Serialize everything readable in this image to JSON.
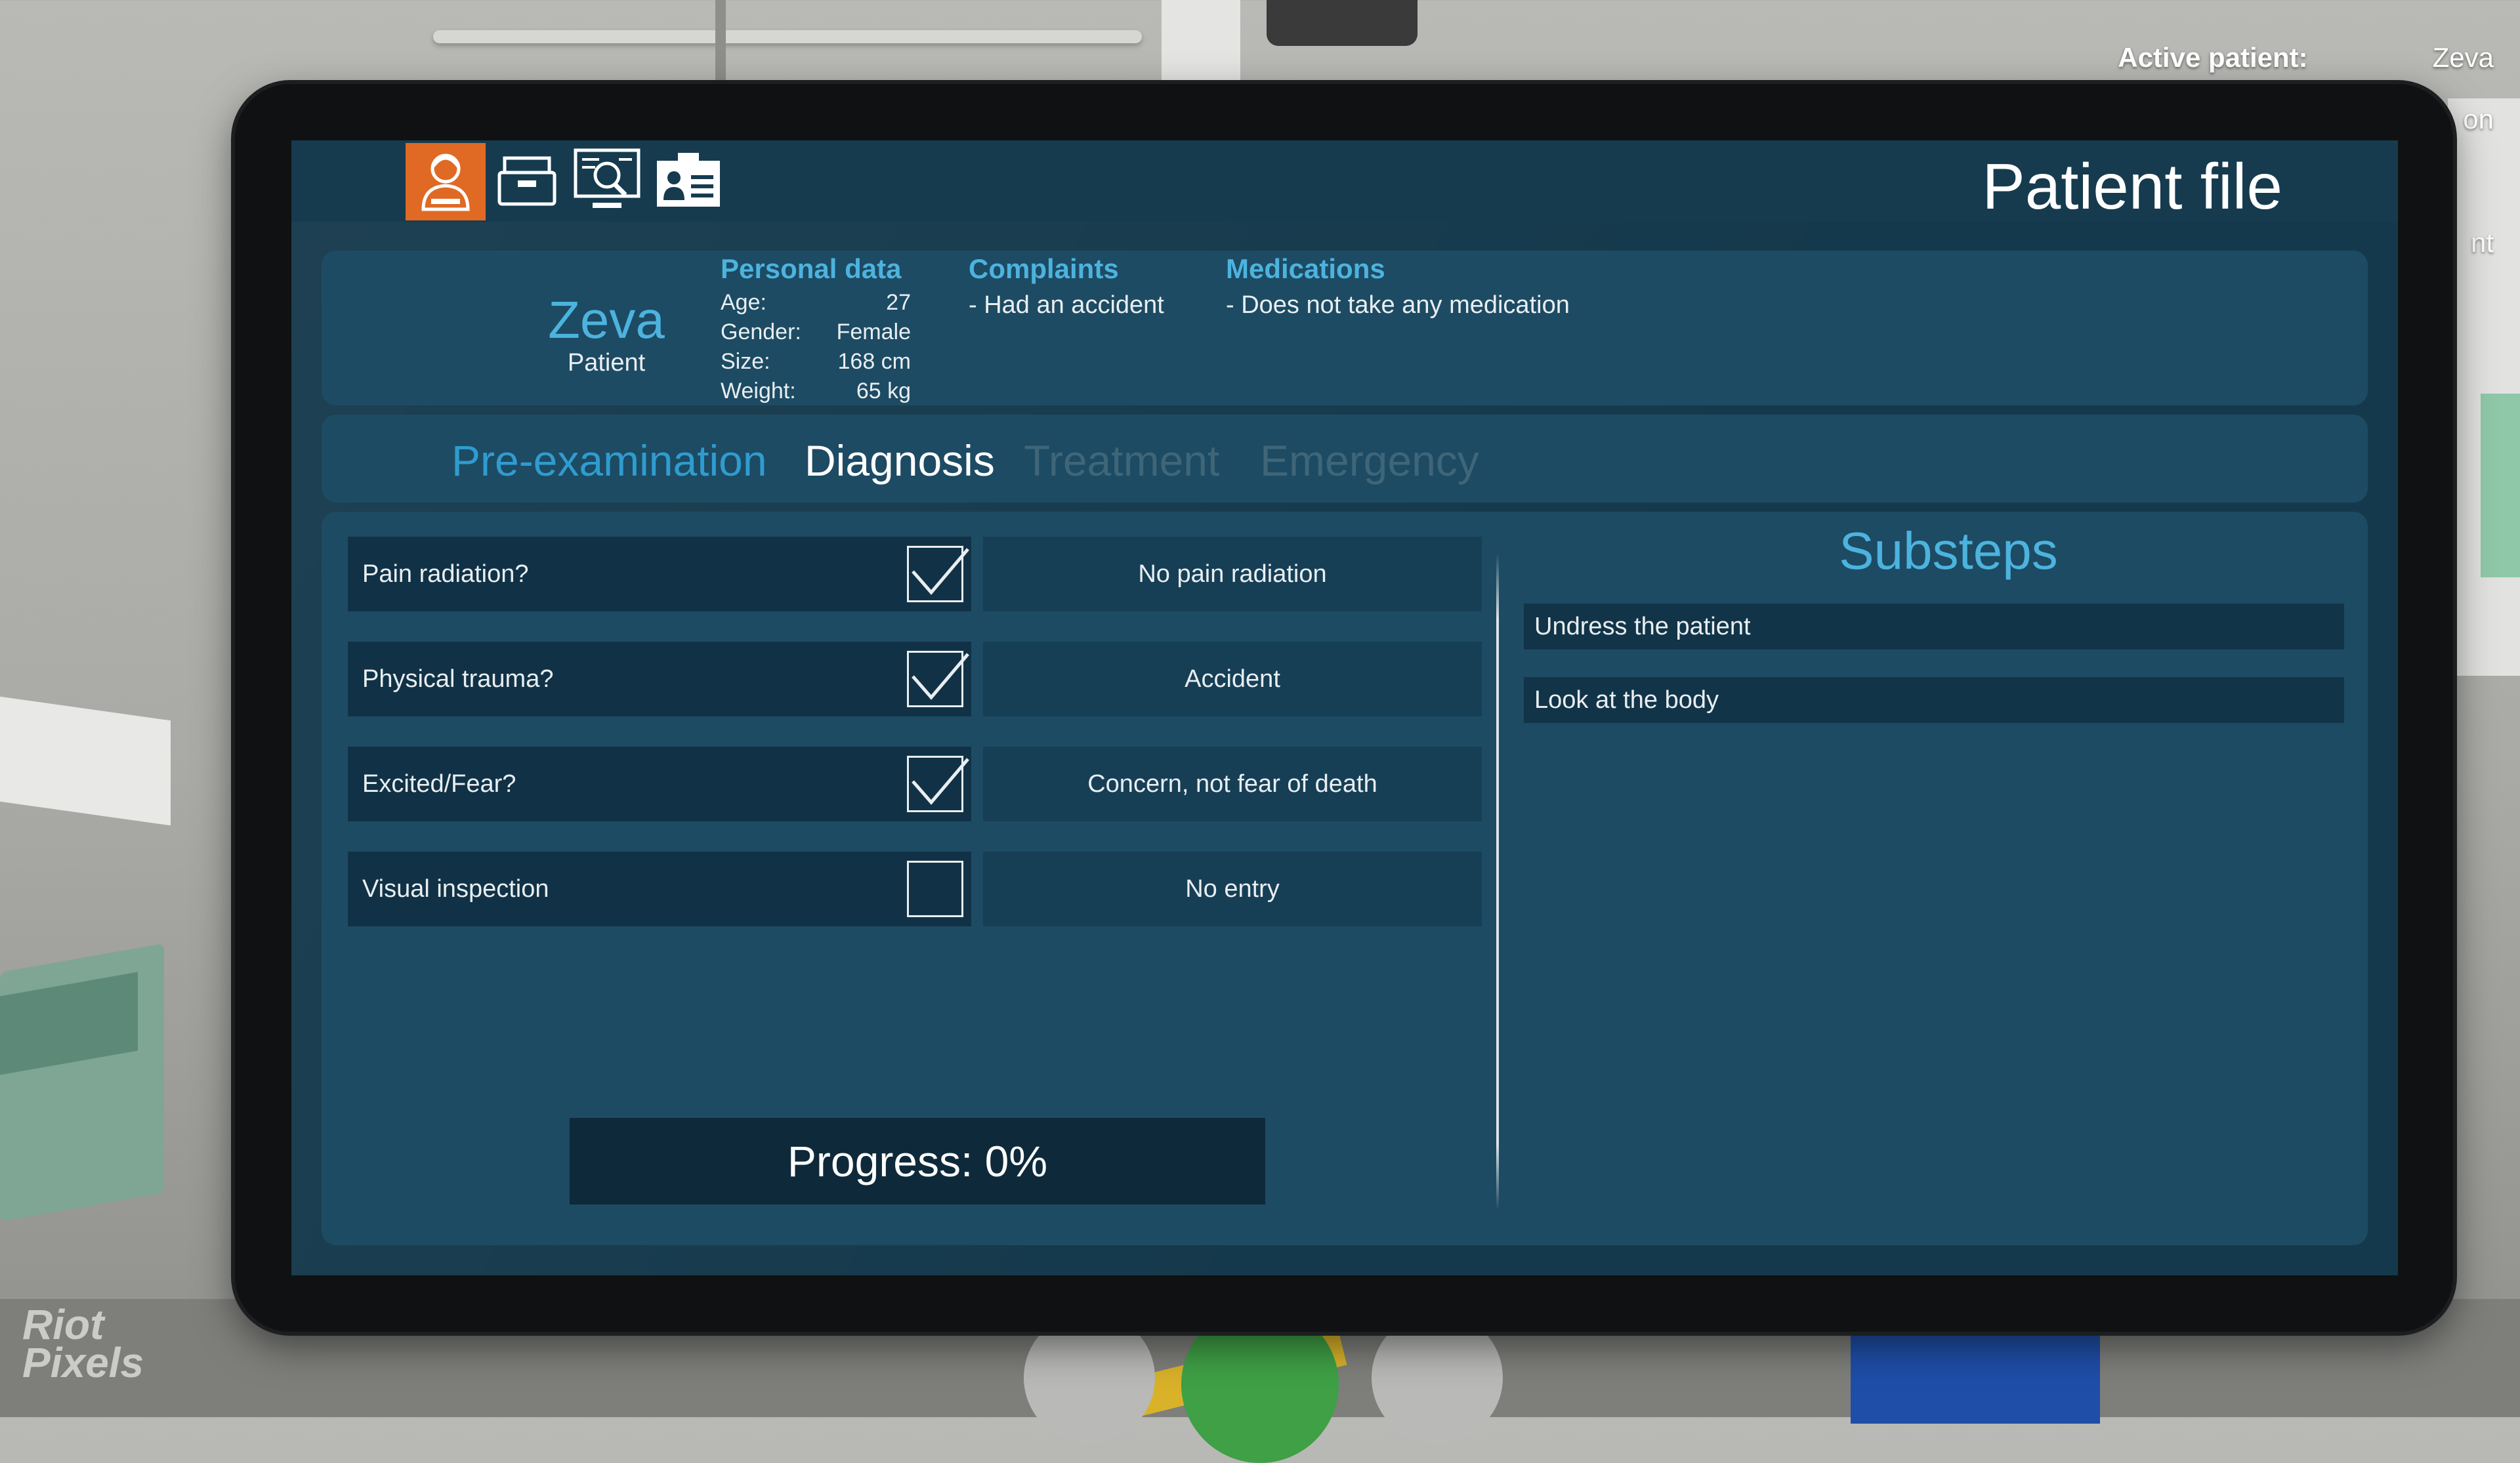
{
  "hud": {
    "active_patient_label": "Active patient:",
    "active_patient_value": "Zeva",
    "partial_line_2": "on",
    "partial_line_3": "nt"
  },
  "watermark": "Riot Pixels",
  "header": {
    "title": "Patient file",
    "nav_icons": [
      {
        "name": "patient-icon",
        "active": true
      },
      {
        "name": "archive-icon",
        "active": false
      },
      {
        "name": "monitor-search-icon",
        "active": false
      },
      {
        "name": "id-card-icon",
        "active": false
      }
    ]
  },
  "patient": {
    "name": "Zeva",
    "role": "Patient"
  },
  "personal_data": {
    "title": "Personal data",
    "fields": [
      {
        "label": "Age:",
        "value": "27"
      },
      {
        "label": "Gender:",
        "value": "Female"
      },
      {
        "label": "Size:",
        "value": "168 cm"
      },
      {
        "label": "Weight:",
        "value": "65 kg"
      }
    ]
  },
  "complaints": {
    "title": "Complaints",
    "items": [
      "- Had an accident"
    ]
  },
  "medications": {
    "title": "Medications",
    "items": [
      "- Does not take any medication"
    ]
  },
  "tabs": [
    {
      "label": "Pre-examination",
      "state": "active",
      "color": "#2f9ccf"
    },
    {
      "label": "Diagnosis",
      "state": "enabled",
      "color": "#ffffff"
    },
    {
      "label": "Treatment",
      "state": "disabled",
      "color": "#3f6678"
    },
    {
      "label": "Emergency",
      "state": "disabled",
      "color": "#3f6678"
    }
  ],
  "questions": [
    {
      "label": "Pain radiation?",
      "checked": true,
      "answer": "No pain radiation"
    },
    {
      "label": "Physical trauma?",
      "checked": true,
      "answer": "Accident"
    },
    {
      "label": "Excited/Fear?",
      "checked": true,
      "answer": "Concern, not fear of death"
    },
    {
      "label": "Visual inspection",
      "checked": false,
      "answer": "No entry"
    }
  ],
  "progress": {
    "label": "Progress: 0%",
    "value": 0
  },
  "substeps": {
    "title": "Substeps",
    "items": [
      "Undress the patient",
      "Look at the body"
    ]
  },
  "colors": {
    "accent": "#4cb3de",
    "active_icon": "#e06a24",
    "panel": "#1d4b63",
    "screen": "#15394c"
  }
}
